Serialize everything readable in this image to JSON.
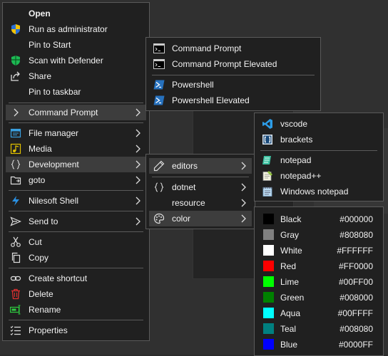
{
  "main_menu": {
    "items": [
      {
        "label": "Open",
        "icon": "open-icon"
      },
      {
        "label": "Run as administrator",
        "icon": "uac-shield-icon"
      },
      {
        "label": "Pin to Start",
        "icon": ""
      },
      {
        "label": "Scan with Defender",
        "icon": "defender-shield-icon"
      },
      {
        "label": "Share",
        "icon": "share-icon"
      },
      {
        "label": "Pin to taskbar",
        "icon": ""
      },
      {
        "label": "Command Prompt",
        "icon": ""
      },
      {
        "label": "File manager",
        "icon": "file-manager-icon"
      },
      {
        "label": "Media",
        "icon": "media-icon"
      },
      {
        "label": "Development",
        "icon": "braces-icon"
      },
      {
        "label": "goto",
        "icon": "folder-icon"
      },
      {
        "label": "Nilesoft Shell",
        "icon": "nilesoft-icon"
      },
      {
        "label": "Send to",
        "icon": "send-icon"
      },
      {
        "label": "Cut",
        "icon": "scissors-icon"
      },
      {
        "label": "Copy",
        "icon": "copy-icon"
      },
      {
        "label": "Create shortcut",
        "icon": "link-icon"
      },
      {
        "label": "Delete",
        "icon": "trash-icon"
      },
      {
        "label": "Rename",
        "icon": "rename-icon"
      },
      {
        "label": "Properties",
        "icon": "properties-icon"
      }
    ]
  },
  "cmd_menu": {
    "items": [
      {
        "label": "Command Prompt"
      },
      {
        "label": "Command Prompt Elevated"
      },
      {
        "label": "Powershell"
      },
      {
        "label": "Powershell Elevated"
      }
    ]
  },
  "dev_menu": {
    "items": [
      {
        "label": "editors"
      },
      {
        "label": "dotnet"
      },
      {
        "label": "resource"
      },
      {
        "label": "color"
      }
    ]
  },
  "editors_menu": {
    "items": [
      {
        "label": "vscode"
      },
      {
        "label": "brackets"
      },
      {
        "label": "notepad"
      },
      {
        "label": "notepad++"
      },
      {
        "label": "Windows notepad"
      }
    ]
  },
  "color_menu": {
    "items": [
      {
        "label": "Black",
        "hex": "#000000"
      },
      {
        "label": "Gray",
        "hex": "#808080"
      },
      {
        "label": "White",
        "hex": "#FFFFFF"
      },
      {
        "label": "Red",
        "hex": "#FF0000"
      },
      {
        "label": "Lime",
        "hex": "#00FF00"
      },
      {
        "label": "Green",
        "hex": "#008000"
      },
      {
        "label": "Aqua",
        "hex": "#00FFFF"
      },
      {
        "label": "Teal",
        "hex": "#008080"
      },
      {
        "label": "Blue",
        "hex": "#0000FF"
      }
    ]
  },
  "colors": {
    "menu_bg": "#202020",
    "highlight": "#3d3d3d",
    "border": "#5a5a5a"
  }
}
